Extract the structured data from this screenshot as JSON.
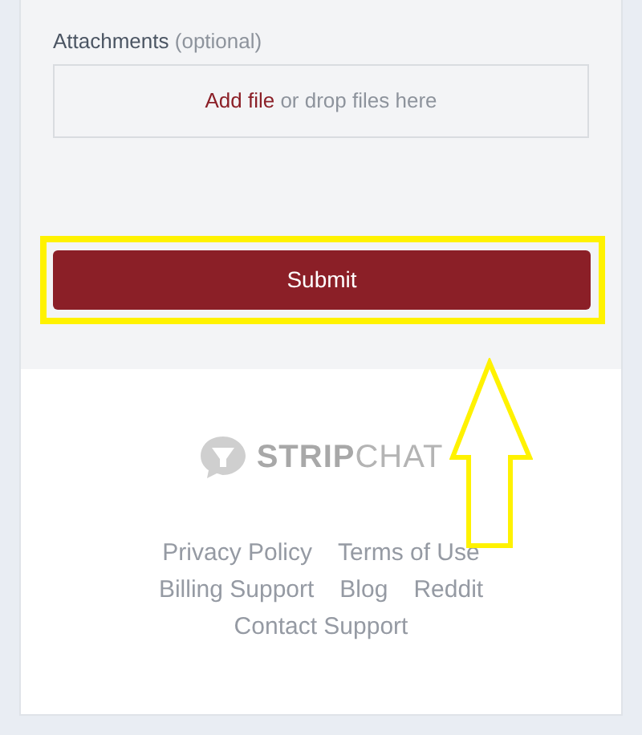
{
  "attachments": {
    "label": "Attachments",
    "hint": "(optional)",
    "dropzone": {
      "link": "Add file",
      "text": "or drop files here"
    }
  },
  "submit": {
    "label": "Submit"
  },
  "footer": {
    "logo": {
      "strong": "STRIP",
      "light": "CHAT"
    },
    "links": [
      "Privacy Policy",
      "Terms of Use",
      "Billing Support",
      "Blog",
      "Reddit",
      "Contact Support"
    ]
  }
}
